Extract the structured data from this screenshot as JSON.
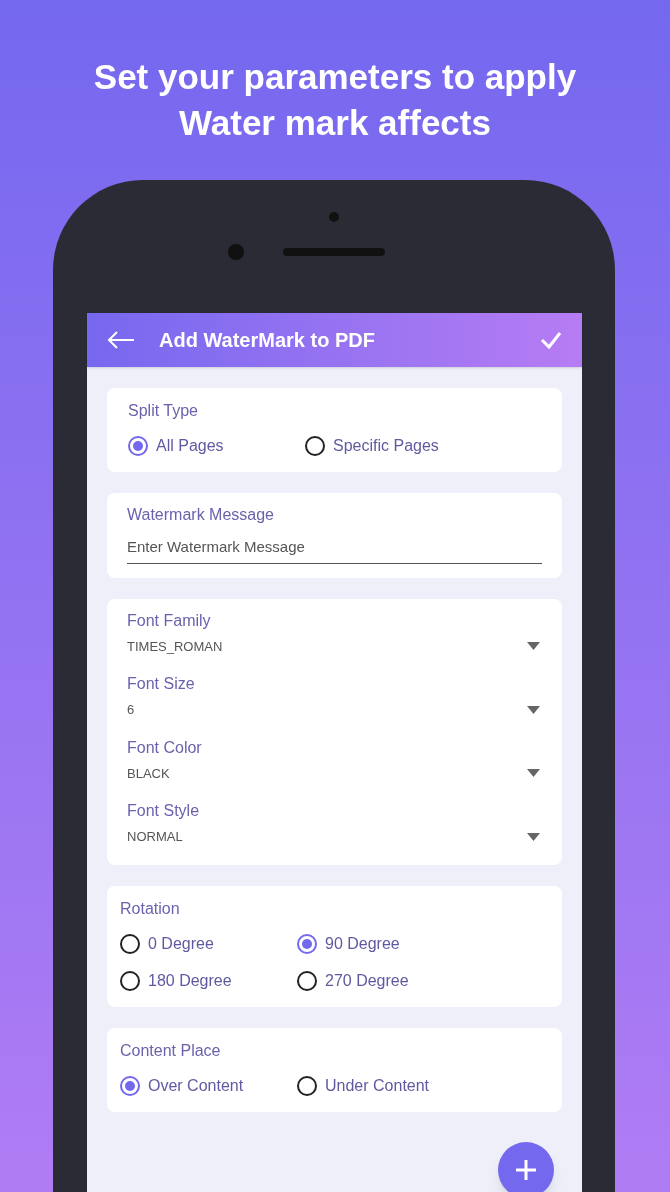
{
  "headline": "Set your parameters to apply\nWater mark affects",
  "app_bar": {
    "title": "Add WaterMark to PDF"
  },
  "sections": [
    {
      "kind": "radio_group",
      "label": "Split Type",
      "options": [
        {
          "label": "All Pages",
          "selected": true
        },
        {
          "label": "Specific Pages",
          "selected": false
        }
      ]
    },
    {
      "kind": "text_field",
      "label": "Watermark Message",
      "placeholder": "Enter Watermark Message"
    },
    {
      "kind": "dropdowns",
      "fields": [
        {
          "label": "Font Family",
          "value": "TIMES_ROMAN"
        },
        {
          "label": "Font Size",
          "value": "6"
        },
        {
          "label": "Font Color",
          "value": "BLACK"
        },
        {
          "label": "Font Style",
          "value": "NORMAL"
        }
      ]
    },
    {
      "kind": "radio_group",
      "label": "Rotation",
      "options": [
        {
          "label": "0 Degree",
          "selected": false
        },
        {
          "label": "90 Degree",
          "selected": true
        },
        {
          "label": "180 Degree",
          "selected": false
        },
        {
          "label": "270 Degree",
          "selected": false
        }
      ]
    },
    {
      "kind": "radio_group",
      "label": "Content Place",
      "options": [
        {
          "label": "Over Content",
          "selected": true
        },
        {
          "label": "Under Content",
          "selected": false
        }
      ]
    }
  ]
}
